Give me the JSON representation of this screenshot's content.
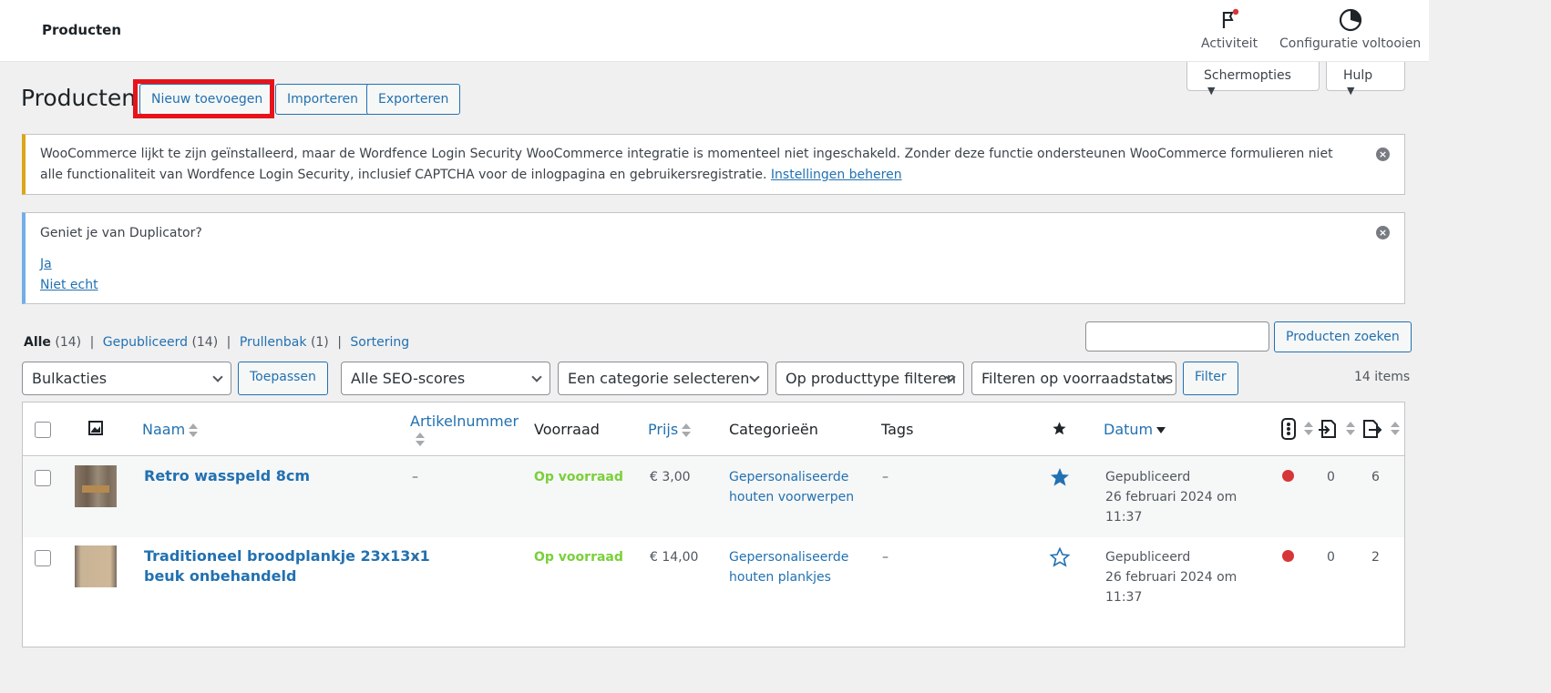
{
  "topbar": {
    "title": "Producten",
    "activity_label": "Activiteit",
    "setup_label": "Configuratie voltooien"
  },
  "screen_options": {
    "screen_label": "Schermopties",
    "help_label": "Hulp"
  },
  "page": {
    "heading": "Producten",
    "add_new": "Nieuw toevoegen",
    "import": "Importeren",
    "export": "Exporteren"
  },
  "notice_wordfence": {
    "text": "WooCommerce lijkt te zijn geïnstalleerd, maar de Wordfence Login Security WooCommerce integratie is momenteel niet ingeschakeld. Zonder deze functie ondersteunen WooCommerce formulieren niet alle functionaliteit van Wordfence Login Security, inclusief CAPTCHA voor de inlogpagina en gebruikersregistratie.",
    "link": "Instellingen beheren",
    "close": "×"
  },
  "notice_duplicator": {
    "question": "Geniet je van Duplicator?",
    "yes": "Ja",
    "no": "Niet echt",
    "close": "×"
  },
  "views": {
    "all": "Alle",
    "all_count": "(14)",
    "published": "Gepubliceerd",
    "published_count": "(14)",
    "trash": "Prullenbak",
    "trash_count": "(1)",
    "sorting": "Sortering",
    "sep": "|"
  },
  "search": {
    "value": "",
    "button": "Producten zoeken"
  },
  "filters": {
    "bulk": "Bulkacties",
    "apply": "Toepassen",
    "seo": "Alle SEO-scores",
    "category": "Een categorie selecteren",
    "product_type": "Op producttype filteren",
    "stock": "Filteren op voorraadstatus",
    "filter_button": "Filter",
    "items_count": "14 items"
  },
  "table": {
    "headers": {
      "name": "Naam",
      "sku": "Artikelnummer",
      "stock": "Voorraad",
      "price": "Prijs",
      "categories": "Categorieën",
      "tags": "Tags",
      "date": "Datum"
    },
    "rows": [
      {
        "name": "Retro wasspeld 8cm",
        "name_line2": "",
        "sku": "–",
        "stock": "Op voorraad",
        "price": "€ 3,00",
        "category_line1": "Gepersonaliseerde",
        "category_line2": "houten voorwerpen",
        "tags": "–",
        "featured": true,
        "status": "Gepubliceerd",
        "date": "26 februari 2024 om",
        "time": "11:37",
        "col_a": "0",
        "col_b": "6"
      },
      {
        "name": "Traditioneel broodplankje 23x13x1",
        "name_line2": "beuk onbehandeld",
        "sku": "–",
        "stock": "Op voorraad",
        "price": "€ 14,00",
        "category_line1": "Gepersonaliseerde",
        "category_line2": "houten plankjes",
        "tags": "–",
        "featured": false,
        "status": "Gepubliceerd",
        "date": "26 februari 2024 om",
        "time": "11:37",
        "col_a": "0",
        "col_b": "2"
      }
    ]
  },
  "colors": {
    "accent": "#2271b1",
    "highlight": "#e8131a",
    "instock": "#7ad03a",
    "warning_border": "#dba617",
    "info_border": "#72aee6"
  }
}
